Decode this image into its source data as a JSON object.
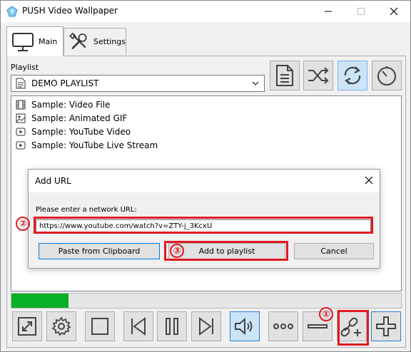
{
  "window": {
    "title": "PUSH Video Wallpaper"
  },
  "tabs": [
    {
      "label": "Main",
      "icon": "monitor-icon"
    },
    {
      "label": "Settings",
      "icon": "tools-icon"
    }
  ],
  "playlist": {
    "label": "Playlist",
    "selected": "DEMO PLAYLIST"
  },
  "items": [
    {
      "label": "Sample: Video File",
      "icon": "film-icon"
    },
    {
      "label": "Sample: Animated GIF",
      "icon": "image-icon"
    },
    {
      "label": "Sample: YouTube Video",
      "icon": "play-icon"
    },
    {
      "label": "Sample: YouTube Live Stream",
      "icon": "play-icon"
    }
  ],
  "progress": {
    "value": 0.146,
    "color": "#06b025"
  },
  "dialog": {
    "title": "Add URL",
    "prompt": "Please enter a network URL:",
    "url_value": "https://www.youtube.com/watch?v=ZTY-j_3KcxU",
    "paste_label": "Paste from Clipboard",
    "add_label": "Add to playlist",
    "cancel_label": "Cancel"
  },
  "annotations": {
    "marker_1": "①",
    "marker_2": "②",
    "marker_3": "③",
    "color": "#e01a22"
  },
  "colors": {
    "accent": "#2d7bd1",
    "active_bg": "#cce4f7"
  }
}
